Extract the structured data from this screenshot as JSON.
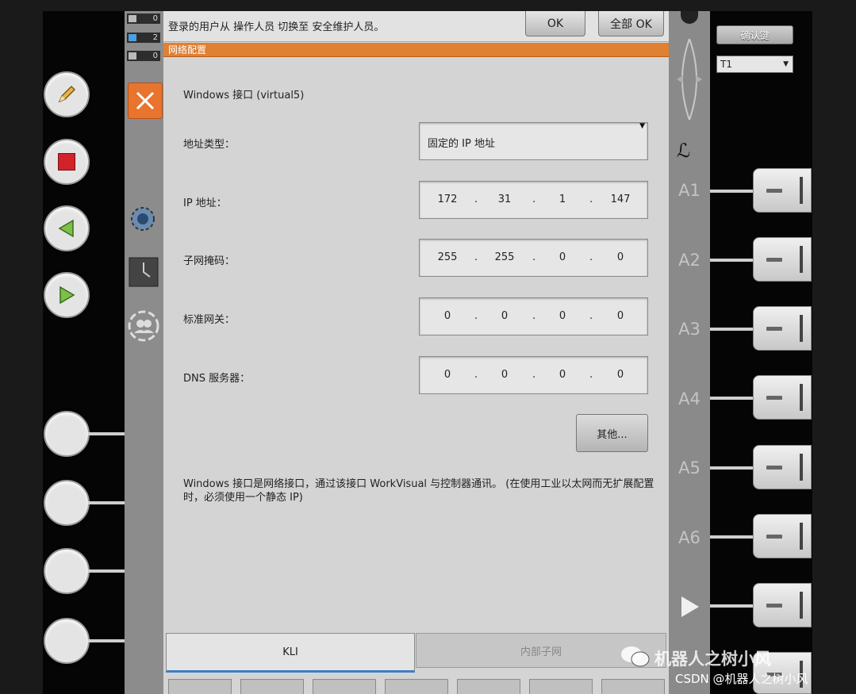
{
  "status_counts": [
    "0",
    "2",
    "0"
  ],
  "message": "登录的用户从 操作人员 切换至 安全维护人员。",
  "buttons": {
    "ok": "OK",
    "all_ok": "全部 OK",
    "close_icon": "close-icon"
  },
  "dialog_title": "网络配置",
  "interface_label": "Windows 接口 (virtual5)",
  "form": {
    "address_type": {
      "label": "地址类型：",
      "value": "固定的 IP 地址"
    },
    "ip": {
      "label": "IP 地址：",
      "octets": [
        "172",
        "31",
        "1",
        "147"
      ]
    },
    "subnet": {
      "label": "子网掩码：",
      "octets": [
        "255",
        "255",
        "0",
        "0"
      ]
    },
    "gateway": {
      "label": "标准网关：",
      "octets": [
        "0",
        "0",
        "0",
        "0"
      ]
    },
    "dns": {
      "label": "DNS 服务器：",
      "octets": [
        "0",
        "0",
        "0",
        "0"
      ]
    }
  },
  "other_button": "其他...",
  "description": "Windows 接口是网络接口，通过该接口 WorkVisual 与控制器通讯。 (在使用工业以太网而无扩展配置时，必须使用一个静态 IP)",
  "tabs": {
    "kli": "KLI",
    "internal": "内部子网"
  },
  "axes": [
    "A1",
    "A2",
    "A3",
    "A4",
    "A5",
    "A6"
  ],
  "right_panel": {
    "confirm": "确认键",
    "mode": "T1"
  },
  "watermark": {
    "main": "机器人之树小风",
    "csdn": "CSDN @机器人之树小风"
  },
  "colors": {
    "accent": "#e08032",
    "tab_underline": "#3d7fc1"
  }
}
